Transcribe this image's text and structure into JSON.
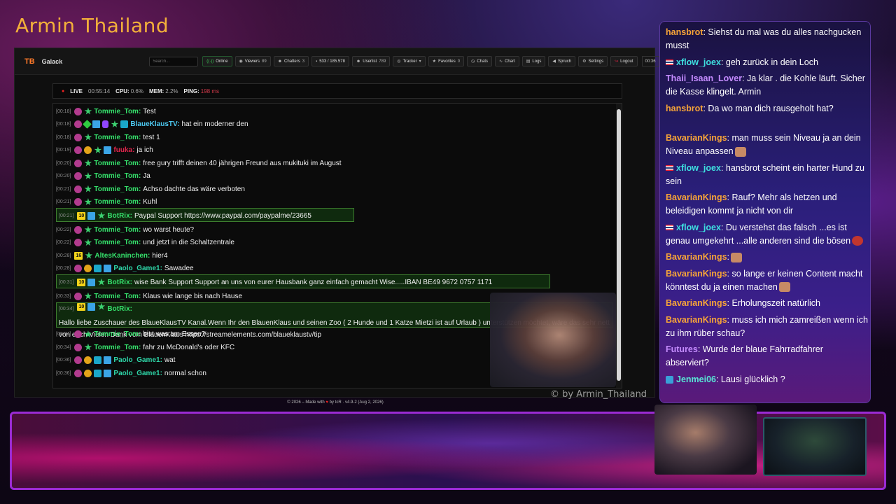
{
  "stream": {
    "title": "Armin Thailand",
    "watermark": "© by Armin_Thailand"
  },
  "app": {
    "brand_logo": "TB",
    "brand_name": "Galack",
    "search_placeholder": "Search...",
    "nav": [
      {
        "icon": "online-icon",
        "glyph": "((·))",
        "label": "Online",
        "count": ""
      },
      {
        "icon": "eye-icon",
        "glyph": "◉",
        "label": "Viewers",
        "count": "89"
      },
      {
        "icon": "users-icon",
        "glyph": "☻",
        "label": "Chatters",
        "count": "3"
      },
      {
        "icon": "chat-icon",
        "glyph": "▪",
        "label": "533 / 185.578",
        "count": ""
      },
      {
        "icon": "userlist-icon",
        "glyph": "☻",
        "label": "Userlist",
        "count": "789"
      },
      {
        "icon": "tracker-icon",
        "glyph": "◎",
        "label": "Tracker",
        "count": "▾"
      },
      {
        "icon": "star-icon",
        "glyph": "★",
        "label": "Favorites",
        "count": "0"
      },
      {
        "icon": "clock-icon",
        "glyph": "◷",
        "label": "Chats",
        "count": ""
      },
      {
        "icon": "chart-icon",
        "glyph": "∿",
        "label": "Chart",
        "count": ""
      },
      {
        "icon": "logs-icon",
        "glyph": "▤",
        "label": "Logs",
        "count": ""
      },
      {
        "icon": "megaphone-icon",
        "glyph": "◀",
        "label": "Spruch",
        "count": ""
      },
      {
        "icon": "gear-icon",
        "glyph": "⚙",
        "label": "Settings",
        "count": ""
      },
      {
        "icon": "logout-icon",
        "glyph": "↪",
        "label": "Logout",
        "count": ""
      }
    ],
    "timer": "00:36",
    "status": {
      "live_label": "LIVE",
      "live_value": "00:55:14",
      "cpu_label": "CPU:",
      "cpu_value": "0.6%",
      "mem_label": "MEM:",
      "mem_value": "2.2%",
      "ping_label": "PING:",
      "ping_value": "198 ms"
    },
    "footer": {
      "before": "© 2026 – Made with",
      "heart": "♥",
      "after": "by tcR · v4.9-2 (Aug 2, 2026)"
    }
  },
  "chat": [
    {
      "ts": "[00:18]",
      "badges": [
        "pink",
        "star"
      ],
      "user": "Tommie_Tom:",
      "color": "u-green",
      "text": "Test"
    },
    {
      "ts": "[00:18]",
      "badges": [
        "pink",
        "green",
        "sq",
        "purple",
        "star",
        "cyan"
      ],
      "user": "BlaueKlausTV:",
      "color": "u-blue",
      "text": "hat ein moderner den"
    },
    {
      "ts": "[00:18]",
      "badges": [
        "pink",
        "star"
      ],
      "user": "Tommie_Tom:",
      "color": "u-green",
      "text": "test 1"
    },
    {
      "ts": "[00:19]",
      "badges": [
        "pink",
        "gold",
        "star",
        "sq"
      ],
      "user": "fuuka:",
      "color": "u-red",
      "text": "ja ich"
    },
    {
      "ts": "[00:20]",
      "badges": [
        "pink",
        "star"
      ],
      "user": "Tommie_Tom:",
      "color": "u-green",
      "text": "free gury trifft deinen 40 jährigen Freund aus mukituki im August"
    },
    {
      "ts": "[00:20]",
      "badges": [
        "pink",
        "star"
      ],
      "user": "Tommie_Tom:",
      "color": "u-green",
      "text": "Ja"
    },
    {
      "ts": "[00:21]",
      "badges": [
        "pink",
        "star"
      ],
      "user": "Tommie_Tom:",
      "color": "u-green",
      "text": "Achso dachte das wäre verboten"
    },
    {
      "ts": "[00:21]",
      "badges": [
        "pink",
        "star"
      ],
      "user": "Tommie_Tom:",
      "color": "u-green",
      "text": "Kuhl"
    },
    {
      "ts": "[00:21]",
      "badges": [
        "lvl10",
        "sq",
        "star"
      ],
      "user": "BotRix:",
      "color": "u-green",
      "text": "Paypal Support https://www.paypal.com/paypalme/23665",
      "highlight": true
    },
    {
      "ts": "[00:22]",
      "badges": [
        "pink",
        "star"
      ],
      "user": "Tommie_Tom:",
      "color": "u-green",
      "text": "wo warst heute?"
    },
    {
      "ts": "[00:22]",
      "badges": [
        "pink",
        "star"
      ],
      "user": "Tommie_Tom:",
      "color": "u-green",
      "text": "und jetzt in die Schaltzentrale"
    },
    {
      "ts": "[00:28]",
      "badges": [
        "lvl16",
        "star"
      ],
      "user": "AltesKaninchen:",
      "color": "u-green",
      "text": "hier4"
    },
    {
      "ts": "[00:28]",
      "badges": [
        "pink",
        "gold",
        "cyan",
        "sq"
      ],
      "user": "Paolo_Game1:",
      "color": "u-teal",
      "text": "Sawadee"
    },
    {
      "ts": "[00:31]",
      "badges": [
        "lvl10",
        "sq",
        "star"
      ],
      "user": "BotRix:",
      "color": "u-green",
      "text": "wise Bank Support Support an uns von eurer Hausbank ganz einfach gemacht Wise.....IBAN BE49 9672 0757 1171",
      "highlight": true
    },
    {
      "ts": "[00:33]",
      "badges": [
        "pink",
        "star"
      ],
      "user": "Tommie_Tom:",
      "color": "u-green",
      "text": "Klaus wie lange bis nach Hause"
    },
    {
      "ts": "[00:34]",
      "badges": [
        "lvl10",
        "sq",
        "star"
      ],
      "user": "BotRix:",
      "color": "u-green",
      "text": "Hallo liebe Zuschauer des BlaueKlausTV Kanal.Wenn Ihr den BlauenKlaus und seinen Zoo ( 2 Hunde und 1 Katze Mietzi ist auf Urlaub ) unterstützen möchtet, wäre das sehr nett von euch Vielen Dank vom BlauenKlaus https://streamelements.com/blaueklaustv/tip",
      "highlight": true,
      "wrap": true
    },
    {
      "ts": "[00:34]",
      "badges": [
        "pink",
        "star"
      ],
      "user": "Tommie_Tom:",
      "color": "u-green",
      "text": "bist was am Essen?"
    },
    {
      "ts": "[00:34]",
      "badges": [
        "pink",
        "star"
      ],
      "user": "Tommie_Tom:",
      "color": "u-green",
      "text": "fahr zu McDonald's oder KFC"
    },
    {
      "ts": "[00:36]",
      "badges": [
        "pink",
        "gold",
        "cyan",
        "sq"
      ],
      "user": "Paolo_Game1:",
      "color": "u-teal",
      "text": "wat"
    },
    {
      "ts": "[00:36]",
      "badges": [
        "pink",
        "gold",
        "cyan",
        "sq"
      ],
      "user": "Paolo_Game1:",
      "color": "u-teal",
      "text": "normal schon"
    }
  ],
  "overlay_chat": [
    {
      "user": "hansbrot",
      "color": "n-orange",
      "text": ": Siehst du mal was du alles nachgucken musst"
    },
    {
      "user": "xflow_joex",
      "color": "n-cyan",
      "flag": true,
      "text": ": geh zurück in dein Loch"
    },
    {
      "user": "Thaii_Isaan_Lover",
      "color": "n-purple",
      "text": ": Ja klar . die Kohle läuft. Sicher die Kasse klingelt. Armin"
    },
    {
      "user": "hansbrot",
      "color": "n-orange",
      "text": ": Da wo man dich rausgeholt hat?"
    },
    {
      "user": "BavarianKings",
      "color": "n-orange",
      "text": ": man muss sein Niveau ja an dein Niveau anpassen",
      "emote": "face"
    },
    {
      "user": "xflow_joex",
      "color": "n-cyan",
      "flag": true,
      "text": ": hansbrot scheint ein harter Hund zu sein"
    },
    {
      "user": "BavarianKings",
      "color": "n-orange",
      "text": ": Rauf? Mehr als hetzen und beleidigen kommt ja nicht von dir"
    },
    {
      "user": "xflow_joex",
      "color": "n-cyan",
      "flag": true,
      "text": ": Du verstehst das falsch ...es ist genau umgekehrt ...alle anderen sind die bösen",
      "emote": "red"
    },
    {
      "user": "BavarianKings",
      "color": "n-orange",
      "text": ":",
      "emote": "face"
    },
    {
      "user": "BavarianKings",
      "color": "n-orange",
      "text": ": so lange er keinen Content macht könntest du ja einen machen",
      "emote": "face"
    },
    {
      "user": "BavarianKings",
      "color": "n-orange",
      "text": ": Erholungszeit natürlich"
    },
    {
      "user": "BavarianKings",
      "color": "n-orange",
      "text": ": muss ich mich zamreißen wenn ich zu ihm rüber schau?"
    },
    {
      "user": "Futures",
      "color": "n-purple",
      "text": ": Wurde der blaue Fahrradfahrer abserviert?"
    },
    {
      "user": "Jenmei06",
      "color": "n-teal",
      "badge": true,
      "text": ": Lausi glücklich ?"
    }
  ]
}
